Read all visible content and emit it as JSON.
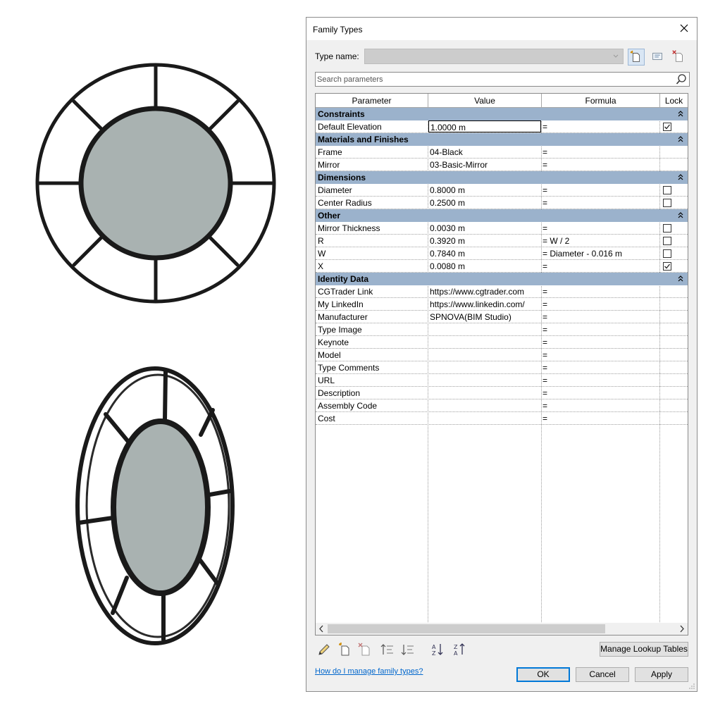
{
  "dialog": {
    "title": "Family Types",
    "type_name_label": "Type name:",
    "type_name_value": "",
    "search_placeholder": "Search parameters",
    "columns": [
      "Parameter",
      "Value",
      "Formula",
      "Lock"
    ],
    "groups": [
      {
        "name": "Constraints",
        "rows": [
          {
            "param": "Default Elevation",
            "value": "1.0000 m",
            "formula": "=",
            "lock": "checked",
            "editing": true
          }
        ]
      },
      {
        "name": "Materials and Finishes",
        "rows": [
          {
            "param": "Frame",
            "value": "04-Black",
            "formula": "=",
            "lock": "none"
          },
          {
            "param": "Mirror",
            "value": "03-Basic-Mirror",
            "formula": "=",
            "lock": "none"
          }
        ]
      },
      {
        "name": "Dimensions",
        "rows": [
          {
            "param": "Diameter",
            "value": "0.8000 m",
            "formula": "=",
            "lock": "unchecked"
          },
          {
            "param": "Center Radius",
            "value": "0.2500 m",
            "formula": "=",
            "lock": "unchecked"
          }
        ]
      },
      {
        "name": "Other",
        "rows": [
          {
            "param": "Mirror Thickness",
            "value": "0.0030 m",
            "formula": "=",
            "lock": "unchecked"
          },
          {
            "param": "R",
            "value": "0.3920 m",
            "formula": "= W / 2",
            "lock": "unchecked"
          },
          {
            "param": "W",
            "value": "0.7840 m",
            "formula": "= Diameter - 0.016 m",
            "lock": "unchecked"
          },
          {
            "param": "X",
            "value": "0.0080 m",
            "formula": "=",
            "lock": "checked"
          }
        ]
      },
      {
        "name": "Identity Data",
        "rows": [
          {
            "param": "CGTrader Link",
            "value": "https://www.cgtrader.com",
            "formula": "=",
            "lock": "none"
          },
          {
            "param": "My LinkedIn",
            "value": "https://www.linkedin.com/",
            "formula": "=",
            "lock": "none"
          },
          {
            "param": "Manufacturer",
            "value": "SPNOVA(BIM Studio)",
            "formula": "=",
            "lock": "none"
          },
          {
            "param": "Type Image",
            "value": "",
            "formula": "=",
            "lock": "none"
          },
          {
            "param": "Keynote",
            "value": "",
            "formula": "=",
            "lock": "none"
          },
          {
            "param": "Model",
            "value": "",
            "formula": "=",
            "lock": "none"
          },
          {
            "param": "Type Comments",
            "value": "",
            "formula": "=",
            "lock": "none"
          },
          {
            "param": "URL",
            "value": "",
            "formula": "=",
            "lock": "none"
          },
          {
            "param": "Description",
            "value": "",
            "formula": "=",
            "lock": "none"
          },
          {
            "param": "Assembly Code",
            "value": "",
            "formula": "=",
            "lock": "none"
          },
          {
            "param": "Cost",
            "value": "",
            "formula": "=",
            "lock": "none"
          }
        ]
      }
    ],
    "manage_lookup_label": "Manage Lookup Tables",
    "help_link": "How do I manage family types?",
    "ok_label": "OK",
    "cancel_label": "Cancel",
    "apply_label": "Apply"
  },
  "icons": {
    "toolbar_top": [
      "new-type-icon",
      "rename-type-icon",
      "delete-type-icon"
    ],
    "toolbar_bottom": [
      "edit-pencil-icon",
      "new-parameter-icon",
      "delete-parameter-icon",
      "move-up-icon",
      "move-down-icon",
      "sort-ascending-icon",
      "sort-descending-icon"
    ]
  },
  "colors": {
    "group_header": "#9bb2cc",
    "mirror_glass": "#a9b2b1",
    "frame": "#1a1a1a",
    "link": "#0066cc",
    "default_button_border": "#0078d7"
  }
}
